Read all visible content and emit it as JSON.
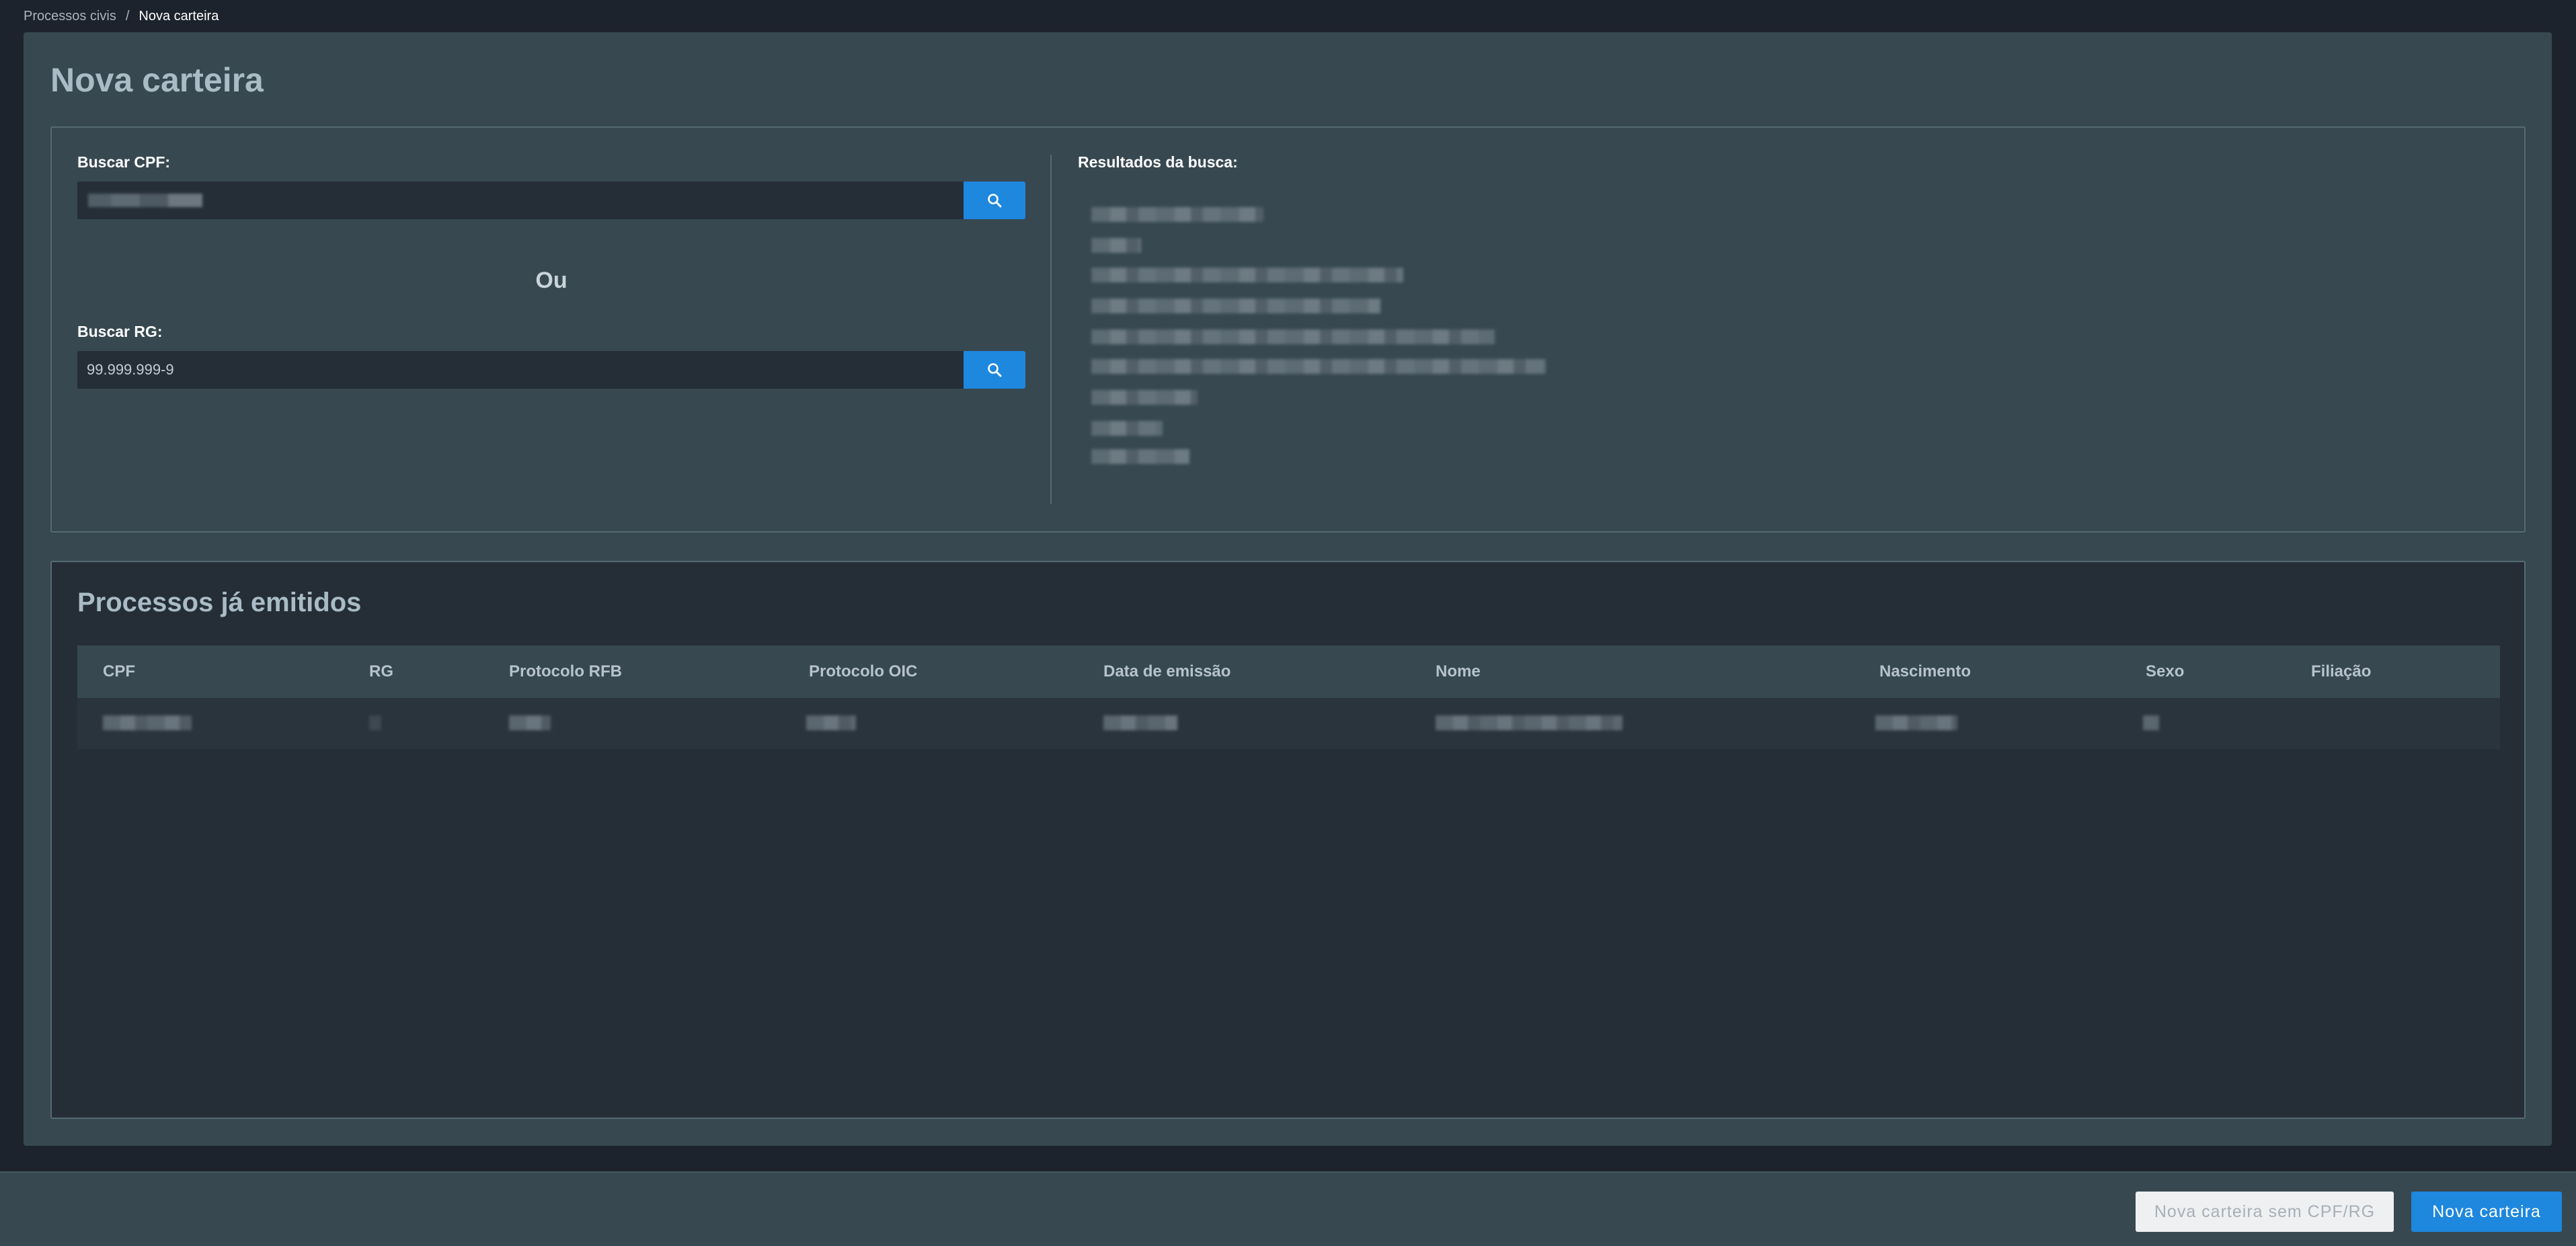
{
  "breadcrumb": {
    "parent": "Processos civis",
    "separator": "/",
    "current": "Nova carteira"
  },
  "page": {
    "title": "Nova carteira"
  },
  "search": {
    "cpf_label": "Buscar CPF:",
    "cpf_value": "",
    "or_text": "Ou",
    "rg_label": "Buscar RG:",
    "rg_placeholder": "99.999.999-9",
    "search_icon": "search-icon",
    "results_label": "Resultados da busca:"
  },
  "processes": {
    "title": "Processos já emitidos",
    "columns": [
      "CPF",
      "RG",
      "Protocolo RFB",
      "Protocolo OIC",
      "Data de emissão",
      "Nome",
      "Nascimento",
      "Sexo",
      "Filiação"
    ]
  },
  "footer": {
    "secondary_button": "Nova carteira sem CPF/RG",
    "primary_button": "Nova carteira"
  },
  "colors": {
    "background": "#1d232c",
    "card": "#374850",
    "panel_dark": "#252e36",
    "accent": "#1e87de",
    "title": "#a9bcc6"
  }
}
